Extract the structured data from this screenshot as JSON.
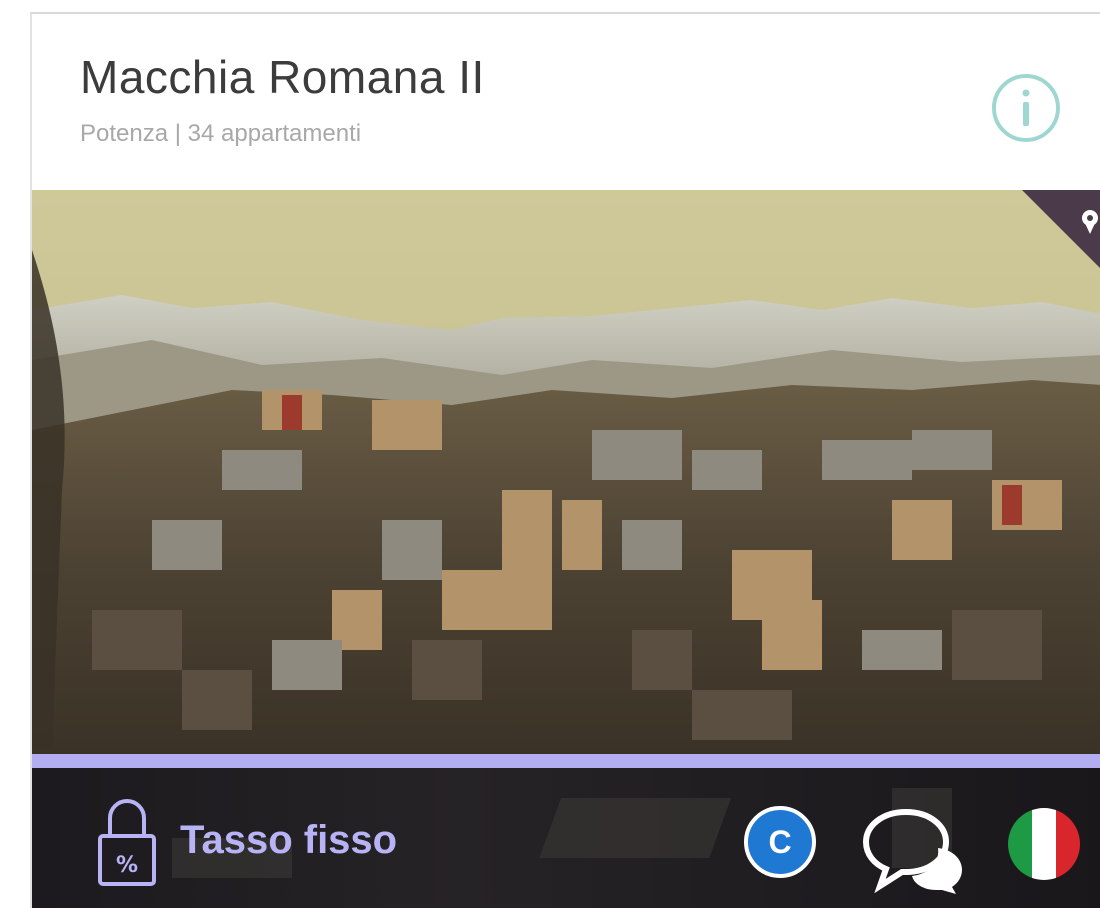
{
  "listing": {
    "title": "Macchia Romana II",
    "subtitle": "Potenza | 34 appartamenti",
    "image_alt": "Potenza city panorama with snowy hills",
    "rate_label": "Tasso fisso",
    "badge_letter": "C"
  },
  "icons": {
    "info": "info-icon",
    "map_marker": "map-marker-icon",
    "lock": "lock-percent-icon",
    "chat": "chat-bubbles-icon",
    "flag": "italy-flag-icon"
  },
  "colors": {
    "accent_bar": "#b3adf2",
    "rate_label": "#b7b3f5",
    "badge_bg": "#1f78d1",
    "info_icon": "#9fd6d2",
    "flag_green": "#1e9a44",
    "flag_white": "#ffffff",
    "flag_red": "#d8262c"
  }
}
